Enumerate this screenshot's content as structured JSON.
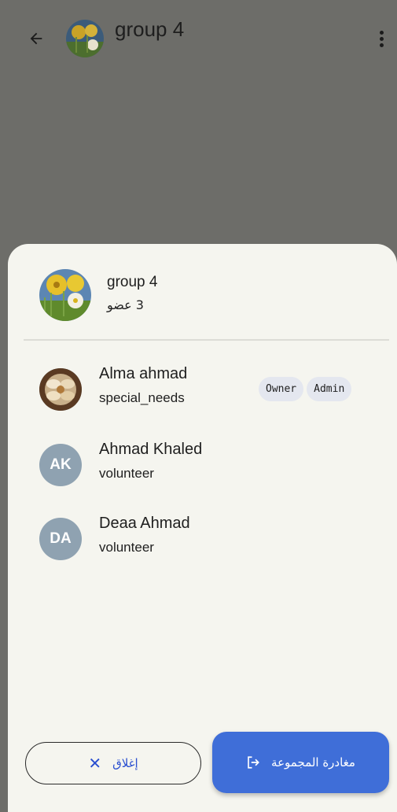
{
  "app_bar": {
    "title": "group 4",
    "back_icon": "arrow-left-icon",
    "more_icon": "more-vertical-icon"
  },
  "sheet": {
    "group_name": "group 4",
    "member_count": "3 عضو",
    "members": [
      {
        "name": "Alma ahmad",
        "role": "special_needs",
        "avatar": "flower-photo",
        "badges": [
          "Owner",
          "Admin"
        ]
      },
      {
        "name": "Ahmad Khaled",
        "role": "volunteer",
        "initials": "AK"
      },
      {
        "name": "Deaa Ahmad",
        "role": "volunteer",
        "initials": "DA"
      }
    ],
    "close_label": "إغلاق",
    "close_icon": "close-icon",
    "leave_label": "مغادرة المجموعة",
    "leave_icon": "logout-icon"
  },
  "colors": {
    "scrim": "#6d6d69",
    "sheet_bg": "#f5f5ef",
    "primary": "#3f6ed8",
    "avatar_bg": "#8fa2b1",
    "badge_bg": "#e4e7ef"
  }
}
